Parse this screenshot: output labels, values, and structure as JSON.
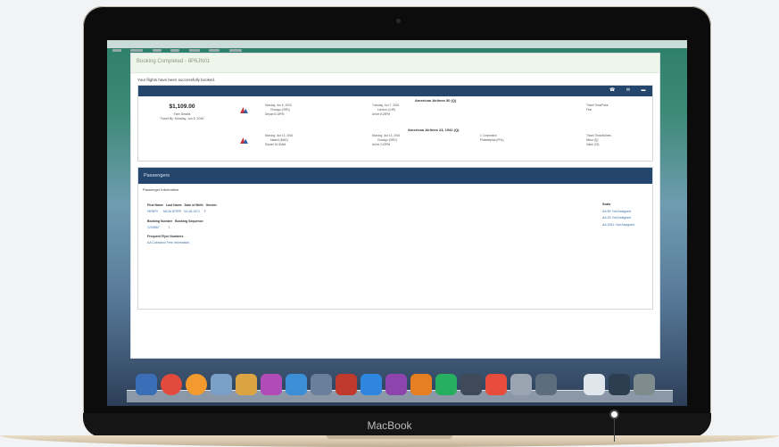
{
  "window": {
    "title": "Booking Completed - 8P6JN01"
  },
  "message": "Your flights have been successfully booked.",
  "summary": {
    "price": "$1,109.00",
    "fare_label": "Fare Details",
    "ticket_by": "Ticket By: Monday, Jun 6, 2016"
  },
  "outbound": {
    "flight_title": "American Airlines 50 (Q)",
    "depart_date": "Monday, Jun 6, 2016",
    "depart_city": "Chicago (ORD)",
    "depart_time": "Depart 6:15PM",
    "arrive_date": "Tuesday, Jun 7, 2016",
    "arrive_city": "London (LHR)",
    "arrive_time": "Arrive 8:25PM",
    "fare_class_label": "Travel Time/Fake",
    "fare_class_value": "Fine"
  },
  "return": {
    "flight_title": "American Airlines 23, 1941 (Q)",
    "depart_date": "Monday, Jun 13, 2016",
    "depart_city": "Madrid (MAD)",
    "depart_time": "Depart 10:30AM",
    "arrive_date": "Monday, Jun 13, 2016",
    "arrive_city": "Chicago (ORD)",
    "arrive_time": "Arrive 2:20PM",
    "stops_label": "1 Connection",
    "stops_value": "Philadelphia (PHL)",
    "fare_class_label": "Travel Time/Airlines",
    "fare_class_value_1": "Minor (Q)",
    "fare_class_value_2": "Value (23)"
  },
  "passengers": {
    "heading": "Passengers",
    "info_label": "Passenger Information",
    "col_first": "First Name",
    "col_last": "Last Name",
    "col_dob": "Date of Birth",
    "col_gender": "Gender",
    "first_value": "HENRY",
    "last_value": "MCALISTER",
    "dob_value": "04-18-1971",
    "gender_value": "F",
    "col_booking": "Booking Number",
    "col_booking_seq": "Booking Sequence",
    "booking_value": "1234567",
    "booking_seq_value": "1",
    "ff_label": "Frequent Flyer Numbers",
    "ff_value": "AA Cobranco Free Information",
    "seats_label": "Seats",
    "seat_1": "AA 50: Not Assigned",
    "seat_2": "AA 23: Not Assigned",
    "seat_3": "AA 1941: Not Assigned"
  },
  "laptop": {
    "brand": "MacBook"
  },
  "colors": {
    "header_blue": "#24466c",
    "link_blue": "#3a6ea5",
    "titlebar_green": "#eef6ec"
  }
}
